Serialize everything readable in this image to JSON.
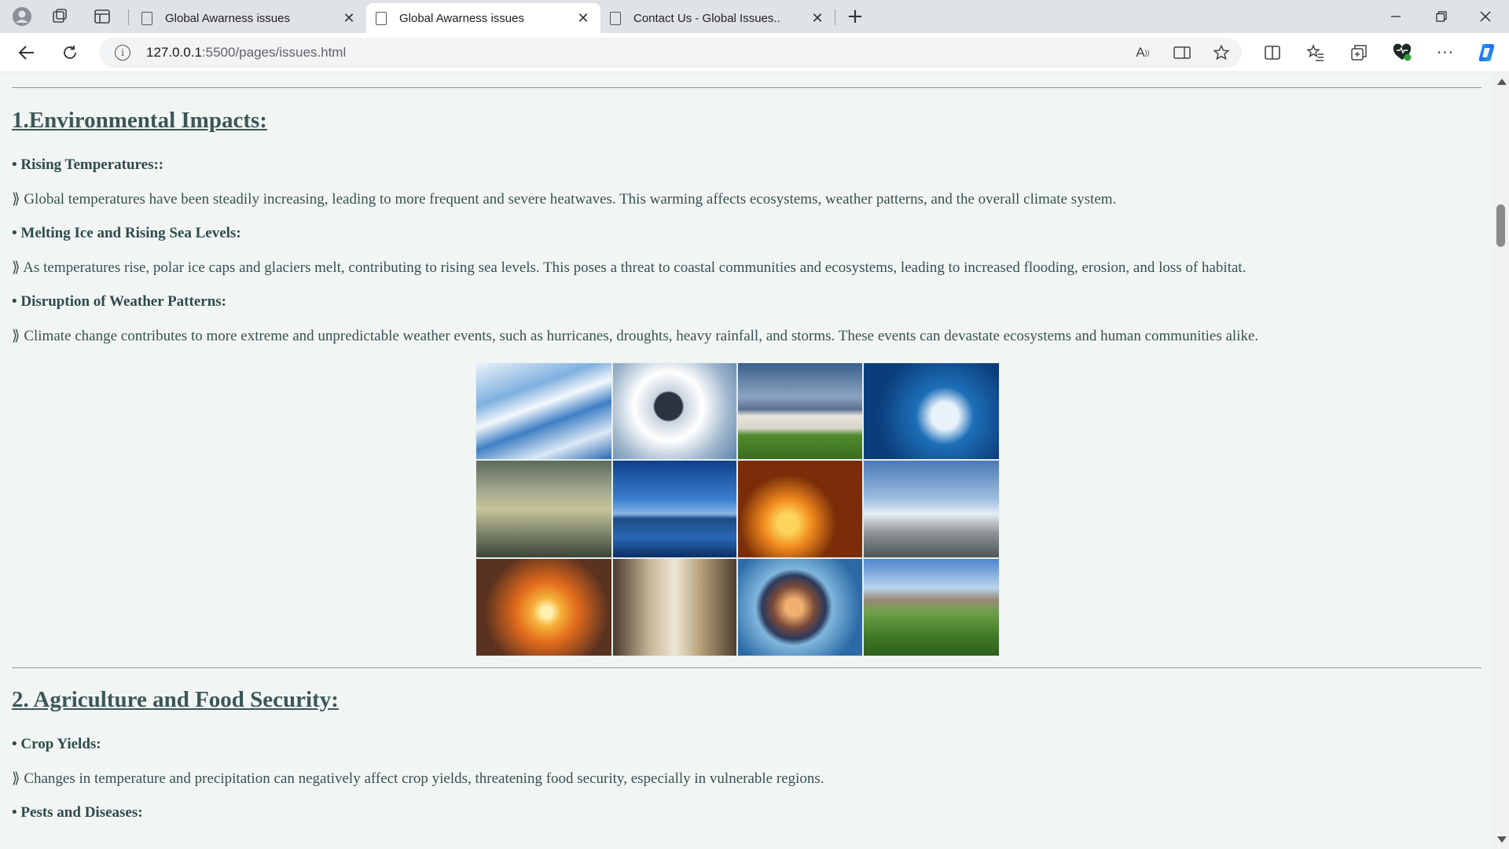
{
  "tabs": [
    {
      "title": "Global Awarness issues",
      "active": false
    },
    {
      "title": "Global Awarness issues",
      "active": true
    },
    {
      "title": "Contact Us - Global Issues..",
      "active": false
    }
  ],
  "address": {
    "host": "127.0.0.1",
    "path": ":5500/pages/issues.html"
  },
  "section1": {
    "heading": "1.Environmental Impacts:",
    "items": [
      {
        "title": "• Rising Temperatures::",
        "text": "⟫ Global temperatures have been steadily increasing, leading to more frequent and severe heatwaves. This warming affects ecosystems, weather patterns, and the overall climate system."
      },
      {
        "title": "• Melting Ice and Rising Sea Levels:",
        "text": "⟫ As temperatures rise, polar ice caps and glaciers melt, contributing to rising sea levels. This poses a threat to coastal communities and ecosystems, leading to increased flooding, erosion, and loss of habitat."
      },
      {
        "title": "• Disruption of Weather Patterns:",
        "text": "⟫ Climate change contributes to more extreme and unpredictable weather events, such as hurricanes, droughts, heavy rainfall, and storms. These events can devastate ecosystems and human communities alike."
      }
    ]
  },
  "gallery": [
    {
      "name": "ice-waves-image",
      "bg": "linear-gradient(160deg,#eaf2fb 0%,#7fb0e0 30%,#f4f8fc 45%,#3f7fc4 60%,#dce9f6 80%,#2a67b0 100%)"
    },
    {
      "name": "clouds-seal-image",
      "bg": "radial-gradient(circle at 45% 45%,#2a3340 0 16%,#c7d3de 18%,#ffffff 40%,#9fb6cc 70%,#5c84ad 100%)"
    },
    {
      "name": "polar-bear-image",
      "bg": "linear-gradient(180deg,#3a5f8c 0%,#8ba4c0 35%,#5c7090 48%,#e8e6dc 55%,#d8d5c8 68%,#4f8b2e 75%,#3a6e20 100%)"
    },
    {
      "name": "underwater-ice-image",
      "bg": "radial-gradient(circle at 60% 55%,#e8f2fa 0 14%,#1d6fb8 30%,#0b3d7a 70%),linear-gradient(90deg,#1b5fa5,#8fc1ea)"
    },
    {
      "name": "smog-city-image",
      "bg": "linear-gradient(180deg,#5c6a5a 0%,#a0a88e 30%,#c8c49a 50%,#7c8468 75%,#3d4538 100%)"
    },
    {
      "name": "mountain-lake-image",
      "bg": "linear-gradient(180deg,#0f3f8a 0%,#3b7fd0 40%,#88b6e6 55%,#1c4c86 60%,#2a66b4 80%,#0a2f63 100%)"
    },
    {
      "name": "fire-smoke-image",
      "bg": "radial-gradient(circle at 40% 65%,#ffd45a 0 10%,#f08a1e 25%,#7a2d08 50%),linear-gradient(180deg,#1e1412 0%,#c06a1a 60%,#4a2410 100%)"
    },
    {
      "name": "power-plant-image",
      "bg": "linear-gradient(180deg,#4a79b8 0%,#9fbfe0 40%,#e6edf4 55%,#8c9294 75%,#4e5558 100%)"
    },
    {
      "name": "sunset-image",
      "bg": "radial-gradient(circle at 52% 55%,#fff2b0 0 6%,#f6b23a 16%,#e26a1c 35%,#5a3220 70%),linear-gradient(180deg,#3a2a30,#b5541e)"
    },
    {
      "name": "forest-road-image",
      "bg": "linear-gradient(90deg,#4a3a2c 0%,#c9b79a 30%,#efe6d6 50%,#b9a37c 70%,#4e3e2c 100%)"
    },
    {
      "name": "earth-water-image",
      "bg": "radial-gradient(circle at 45% 50%,#f0b070 0 10%,#7a4a3a 25%,#2b3a5c 38%,#7fb6dc 46%,#2b6aa6 80%)"
    },
    {
      "name": "green-valley-city-image",
      "bg": "linear-gradient(180deg,#4e86cf 0%,#b8d4ee 30%,#9a8a7a 42%,#6fa04a 55%,#3f7a26 80%,#2e5e1a 100%)"
    }
  ],
  "section2": {
    "heading": "2. Agriculture and Food Security:",
    "items": [
      {
        "title": "• Crop Yields:",
        "text": "⟫ Changes in temperature and precipitation can negatively affect crop yields, threatening food security, especially in vulnerable regions."
      },
      {
        "title": "• Pests and Diseases:",
        "text": ""
      }
    ]
  }
}
